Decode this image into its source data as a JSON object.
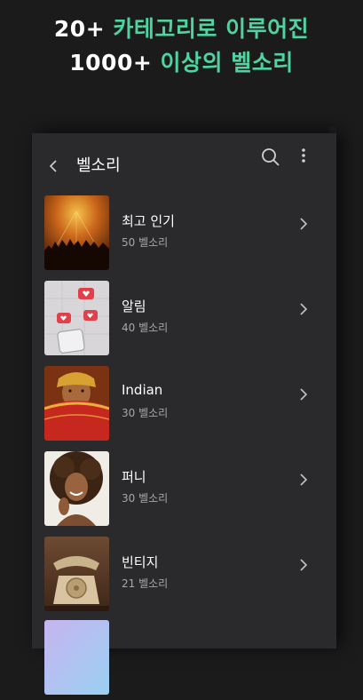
{
  "headline": {
    "line1_a": "20+ ",
    "line1_b": "카테고리로 이루어진",
    "line2_a": "1000+ ",
    "line2_b": "이상의 벨소리"
  },
  "toolbar": {
    "title": "벨소리",
    "back_icon": "chevron-left-icon",
    "search_icon": "search-icon",
    "more_icon": "more-vertical-icon"
  },
  "categories": [
    {
      "name": "최고 인기",
      "count": "50 벨소리",
      "image": "concert-crowd"
    },
    {
      "name": "알림",
      "count": "40 벨소리",
      "image": "phone-notifications"
    },
    {
      "name": "Indian",
      "count": "30 벨소리",
      "image": "indian-woman"
    },
    {
      "name": "퍼니",
      "count": "30 벨소리",
      "image": "laughing-woman"
    },
    {
      "name": "빈티지",
      "count": "21 벨소리",
      "image": "vintage-telephone"
    }
  ],
  "colors": {
    "accent": "#4fd3a0",
    "background": "#1b1b1b",
    "panel": "#2a2a2c"
  }
}
